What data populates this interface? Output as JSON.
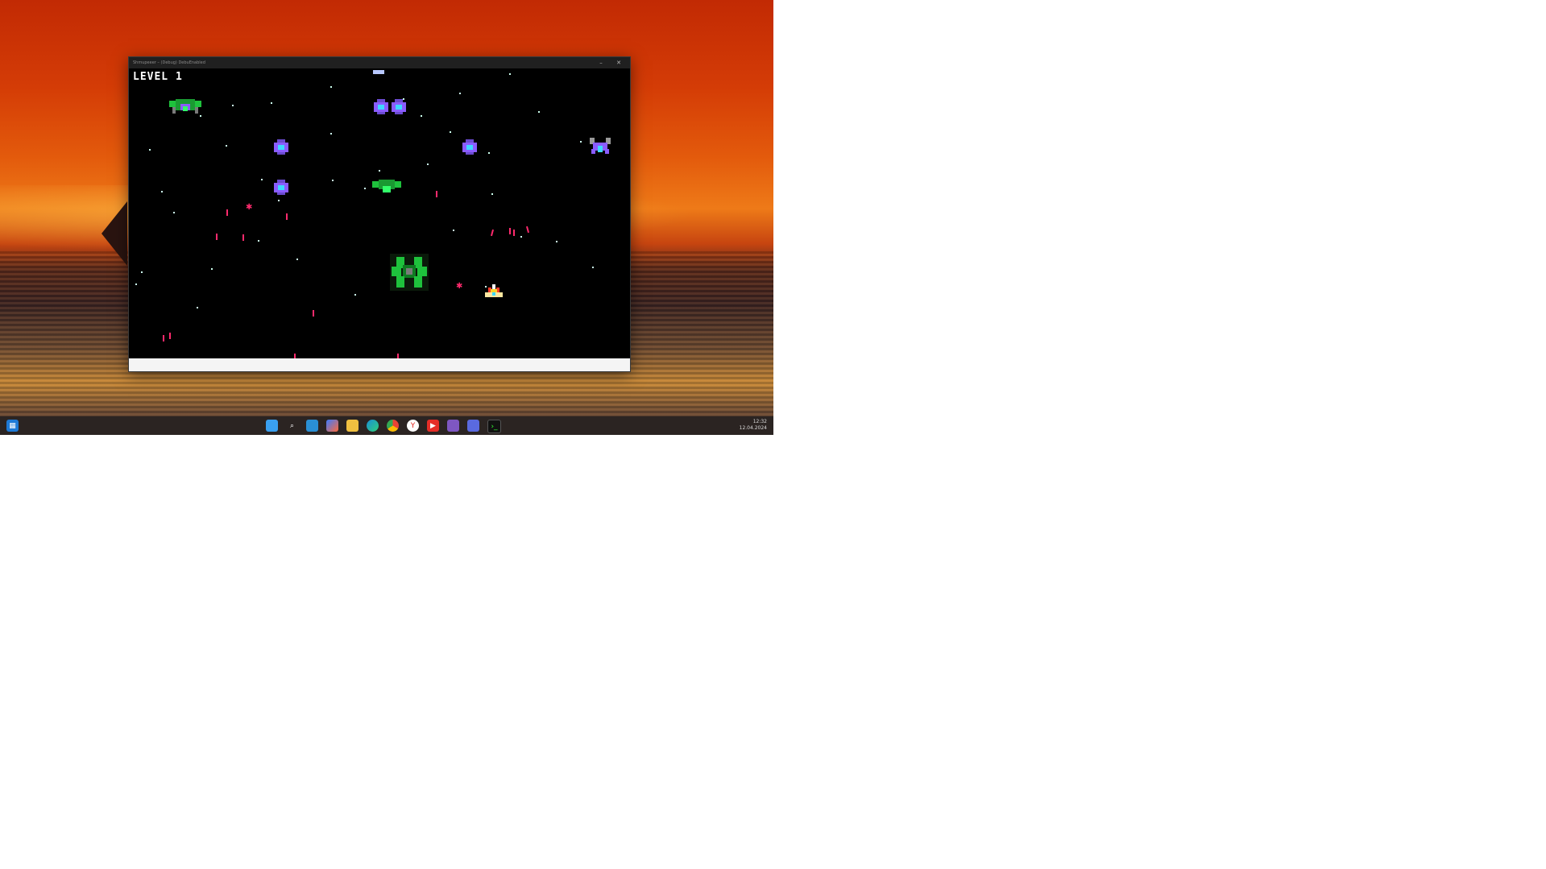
{
  "window": {
    "title": "Shmupeeer – (Debug) DebuEnabled"
  },
  "game": {
    "level_label": "LEVEL 1"
  },
  "taskbar": {
    "icons": [
      "start-icon",
      "widgets-icon",
      "search-icon",
      "notepad-icon",
      "copilot-icon",
      "file-explorer-icon",
      "edge-icon",
      "chrome-icon",
      "yandex-icon",
      "youtube-icon",
      "visual-studio-icon",
      "floppy-save-icon",
      "terminal-icon"
    ],
    "time": "12:32",
    "date": "12.04.2024"
  },
  "colors": {
    "bullet": "#ff2a6d",
    "enemy_purple": "#8a5cff",
    "enemy_green": "#1ec23c",
    "player": "#ffd12a"
  }
}
